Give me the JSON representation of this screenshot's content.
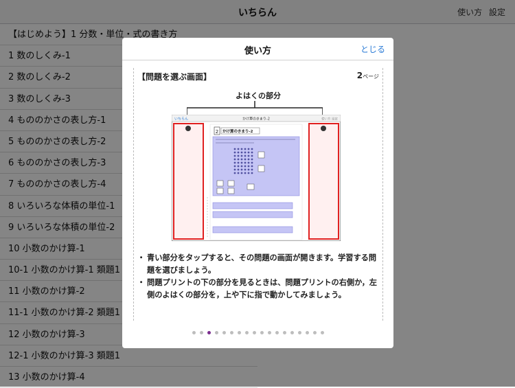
{
  "header": {
    "title": "いちらん",
    "usage_label": "使い方",
    "settings_label": "設定"
  },
  "list": {
    "items": [
      "【はじめよう】1 分数・単位・式の書き方",
      "1 数のしくみ-1",
      "2 数のしくみ-2",
      "3 数のしくみ-3",
      "4 もののかさの表し方-1",
      "5 もののかさの表し方-2",
      "6 もののかさの表し方-3",
      "7 もののかさの表し方-4",
      "8 いろいろな体積の単位-1",
      "9 いろいろな体積の単位-2",
      "10 小数のかけ算-1",
      "10-1 小数のかけ算-1 類題1",
      "11 小数のかけ算-2",
      "11-1 小数のかけ算-2 類題1",
      "12 小数のかけ算-3",
      "12-1 小数のかけ算-3 類題1",
      "13 小数のかけ算-4"
    ]
  },
  "modal": {
    "title": "使い方",
    "close_label": "とじる",
    "section_title": "【問題を選ぶ画面】",
    "page_number": "2",
    "page_suffix": "ページ",
    "margin_label": "よはくの部分",
    "notes": [
      "青い部分をタップすると、その問題の画面が開きます。学習する問題を選びましょう。",
      "問題プリントの下の部分を見るときは、問題プリントの右側か，左側のよはくの部分を，上や下に指で動かしてみましょう。"
    ],
    "dots_total": 18,
    "dots_active_index": 2
  },
  "preview": {
    "nav_left": "いちらん",
    "nav_title": "かけ算のきまり-2",
    "nav_right": "使い方 設定",
    "print_label": "かけ算のきまり-2",
    "problem_number": "2"
  },
  "colors": {
    "accent": "#2b7bd6",
    "highlight_red": "#e02020",
    "question_blue": "#c5c5f5",
    "dot_active": "#7b2d8e"
  }
}
